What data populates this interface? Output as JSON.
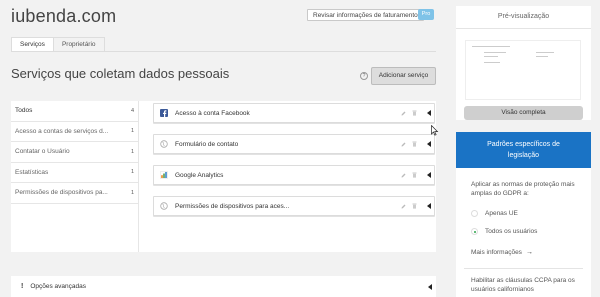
{
  "header": {
    "brand": "iubenda.com",
    "billing_button": "Revisar informações de faturamento",
    "plan_badge": "Pro"
  },
  "tabs": [
    {
      "label": "Serviços",
      "active": true
    },
    {
      "label": "Proprietário",
      "active": false
    }
  ],
  "main": {
    "title": "Serviços que coletam dados pessoais",
    "help_icon": "?",
    "add_button": "Adicionar serviço"
  },
  "categories": [
    {
      "label": "Todos",
      "count": "4",
      "active": true
    },
    {
      "label": "Acesso a contas de serviços d...",
      "count": "1"
    },
    {
      "label": "Contatar o Usuário",
      "count": "1"
    },
    {
      "label": "Estatísticas",
      "count": "1"
    },
    {
      "label": "Permissões de dispositivos pa...",
      "count": "1"
    }
  ],
  "services": [
    {
      "label": "Acesso à conta Facebook",
      "icon": "facebook-icon"
    },
    {
      "label": "Formulário de contato",
      "icon": "globe-icon"
    },
    {
      "label": "Google Analytics",
      "icon": "google-analytics-icon"
    },
    {
      "label": "Permissões de dispositivos para aces...",
      "icon": "globe-icon"
    }
  ],
  "advanced": {
    "icon": "!",
    "label": "Opções avançadas"
  },
  "preview": {
    "title": "Pré-visualização",
    "full_view_button": "Visão completa"
  },
  "gdpr": {
    "heading_line1": "Padrões específicos de",
    "heading_line2": "legislação",
    "description": "Aplicar as normas de proteção mais amplas do GDPR a:",
    "option_eu": "Apenas UE",
    "option_all": "Todos os usuários",
    "more_info": "Mais informações",
    "ccpa_text": "Habilitar as cláusulas CCPA para os usuários californianos"
  },
  "colors": {
    "accent_blue": "#1a73c5",
    "pro_badge": "#7fc3e8",
    "radio_checked": "#2aa44a",
    "facebook": "#3b5998"
  }
}
